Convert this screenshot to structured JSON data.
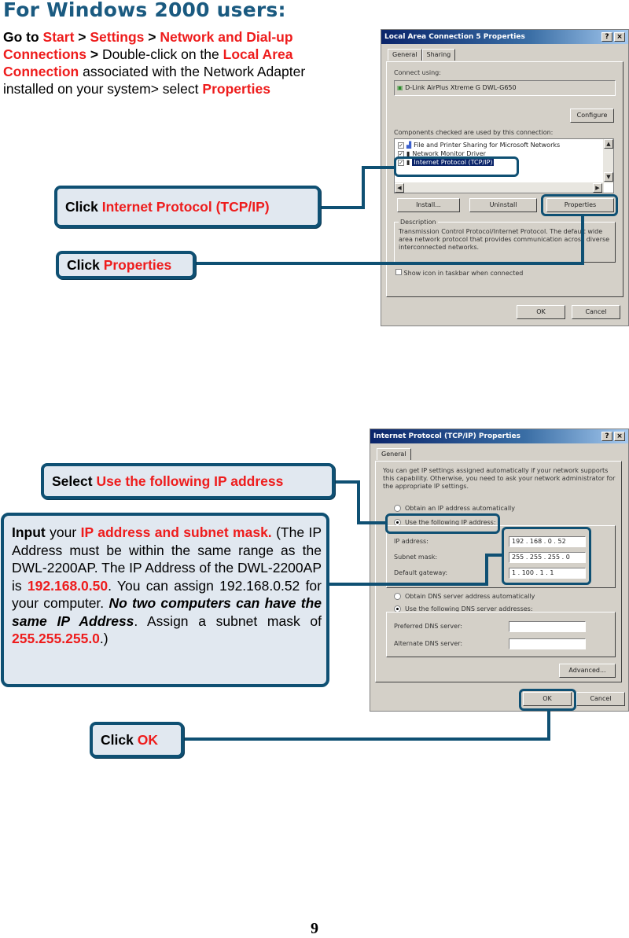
{
  "page_title": "For Windows 2000 users:",
  "intro": {
    "p1": "Go to ",
    "start": "Start",
    "sep1": " > ",
    "settings": "Settings",
    "sep2": " > ",
    "network": "Network and Dial-up Connections",
    "sep3": " > ",
    "p2": "Double-click on the ",
    "lac": "Local Area Connection",
    "p3": " associated with the Network  Adapter installed on your system> select ",
    "properties": "Properties"
  },
  "callouts": {
    "tcpip": {
      "prefix": "Click ",
      "highlight": "Internet Protocol (TCP/IP)"
    },
    "properties": {
      "prefix": "Click ",
      "highlight": "Properties"
    },
    "use_ip": {
      "prefix": "Select ",
      "highlight": "Use the following IP address"
    },
    "ok": {
      "prefix": "Click ",
      "highlight": "OK"
    }
  },
  "infobox": {
    "input": "Input",
    "your": " your ",
    "ip_subnet": "IP address and subnet mask.",
    "line2": " (The IP Address must be within the same range as the DWL-2200AP. The IP Address of the DWL-2200AP  is ",
    "ap_ip": "192.168.0.50",
    "line3": ".  You can assign 192.168.0.52 for your computer. ",
    "warning": "No two computers can have the same IP Address",
    "line4": ".  Assign a subnet mask of ",
    "mask": "255.255.255.0",
    "end": ".)"
  },
  "dialog1": {
    "title": "Local Area Connection 5 Properties",
    "help_btn": "?",
    "close_btn": "×",
    "tabs": [
      "General",
      "Sharing"
    ],
    "connect_using_label": "Connect using:",
    "adapter": "D-Link AirPlus Xtreme G DWL-G650",
    "configure_btn": "Configure",
    "components_label": "Components checked are used by this connection:",
    "components": [
      {
        "label": "File and Printer Sharing for Microsoft Networks",
        "checked": true,
        "selected": false
      },
      {
        "label": "Network Monitor Driver",
        "checked": true,
        "selected": false
      },
      {
        "label": "Internet Protocol (TCP/IP)",
        "checked": true,
        "selected": true
      }
    ],
    "install_btn": "Install...",
    "uninstall_btn": "Uninstall",
    "properties_btn": "Properties",
    "description_label": "Description",
    "description_text": "Transmission Control Protocol/Internet Protocol. The default wide area network protocol that provides communication across diverse interconnected networks.",
    "show_icon_label": "Show icon in taskbar when connected",
    "ok_btn": "OK",
    "cancel_btn": "Cancel"
  },
  "dialog2": {
    "title": "Internet Protocol (TCP/IP) Properties",
    "help_btn": "?",
    "close_btn": "×",
    "tabs": [
      "General"
    ],
    "intro_text": "You can get IP settings assigned automatically if your network supports this capability. Otherwise, you need to ask your network administrator for the appropriate IP settings.",
    "obtain_ip": "Obtain an IP address automatically",
    "use_ip": "Use the following IP address:",
    "ip_label": "IP address:",
    "ip_value": "192 . 168 .  0  . 52",
    "subnet_label": "Subnet mask:",
    "subnet_value": "255 . 255 . 255 . 0",
    "gateway_label": "Default gateway:",
    "gateway_value": "1 . 100 .  1  . 1",
    "obtain_dns": "Obtain DNS server address automatically",
    "use_dns": "Use the following DNS server addresses:",
    "preferred_dns_label": "Preferred DNS server:",
    "alternate_dns_label": "Alternate DNS server:",
    "advanced_btn": "Advanced...",
    "ok_btn": "OK",
    "cancel_btn": "Cancel"
  },
  "page_number": "9",
  "colors": {
    "accent_red": "#ee1c1c",
    "callout_border": "#0f5073",
    "callout_fill": "#e1e8f0",
    "title_blue": "#1a5a80"
  }
}
